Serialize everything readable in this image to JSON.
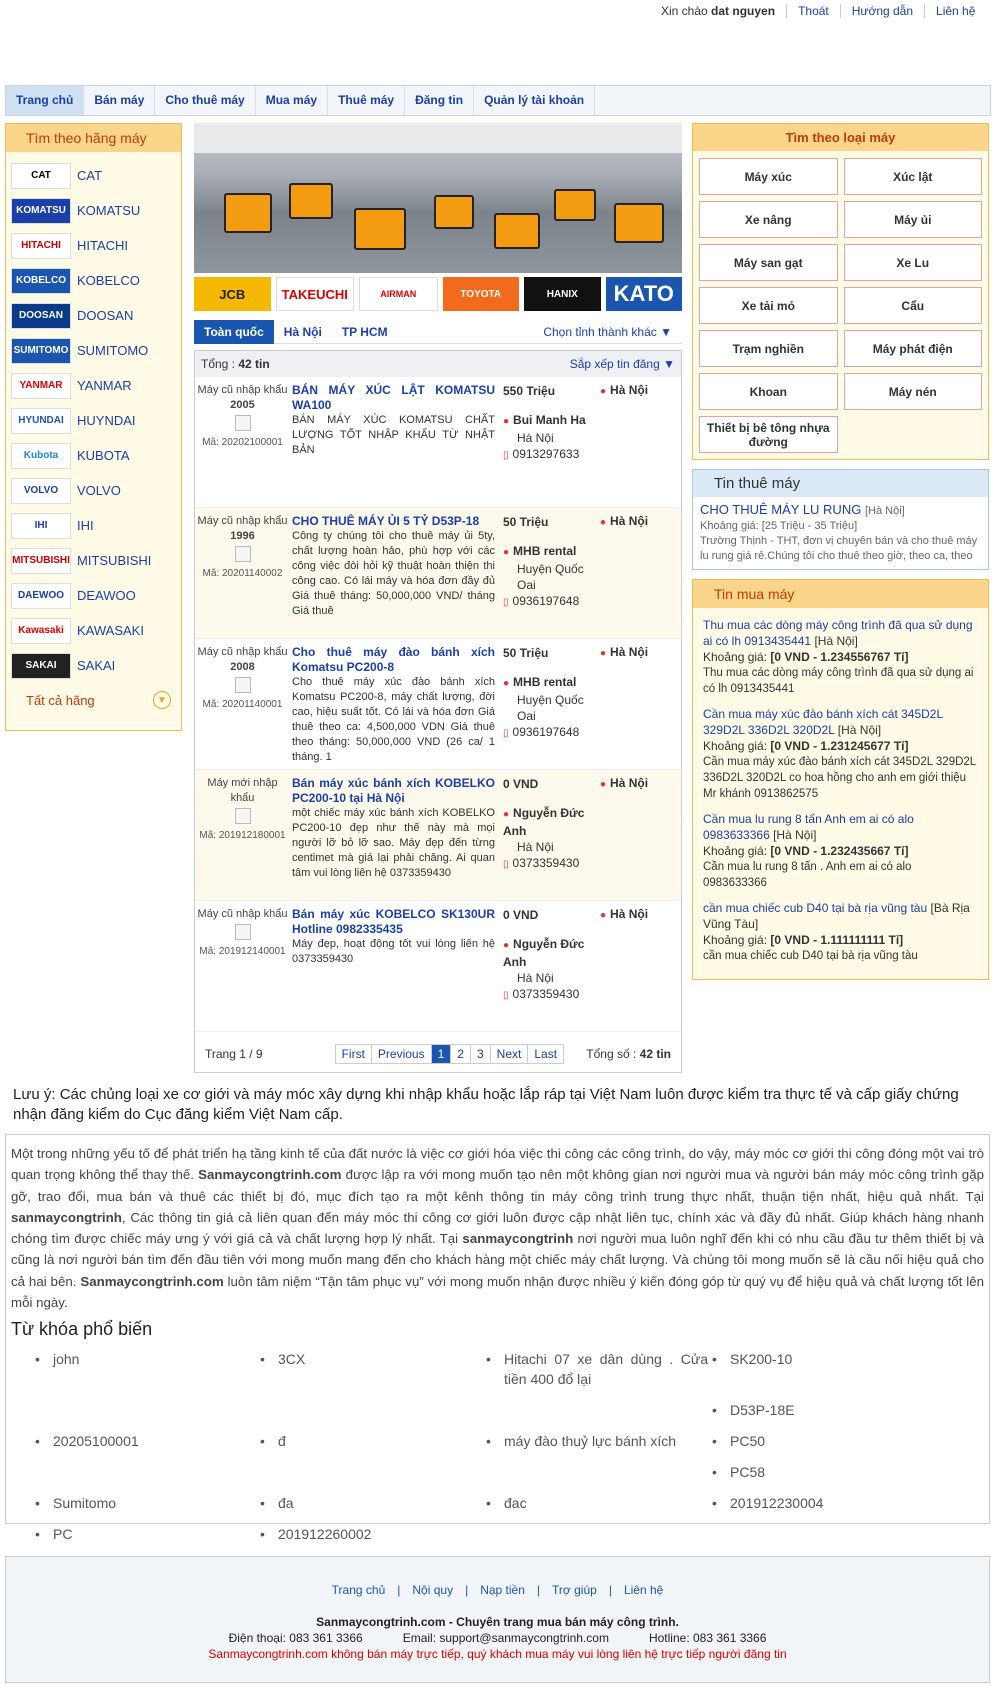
{
  "topbar": {
    "greeting": "Xin chào",
    "user": "dat nguyen",
    "logout": "Thoát",
    "guide": "Hướng dẫn",
    "contact": "Liên hệ"
  },
  "nav": [
    "Trang chủ",
    "Bán máy",
    "Cho thuê máy",
    "Mua máy",
    "Thuê máy",
    "Đăng tin",
    "Quản lý tài khoản"
  ],
  "brands": {
    "title": "Tìm theo hãng máy",
    "items": [
      "CAT",
      "KOMATSU",
      "HITACHI",
      "KOBELCO",
      "DOOSAN",
      "SUMITOMO",
      "YANMAR",
      "HUYNDAI",
      "KUBOTA",
      "VOLVO",
      "IHI",
      "MITSUBISHI",
      "DEAWOO",
      "KAWASAKI",
      "SAKAI"
    ],
    "all": "Tất cả hãng"
  },
  "logos": [
    "JCB",
    "TAKEUCHI",
    "AIRMAN",
    "TOYOTA",
    "HANIX",
    "KATO"
  ],
  "tabs": {
    "all": "Toàn quốc",
    "hn": "Hà Nội",
    "hcm": "TP HCM",
    "city": "Chọn tỉnh thành khác"
  },
  "list": {
    "total_label": "Tổng :",
    "total": "42 tin",
    "sort": "Sắp xếp tin đăng",
    "items": [
      {
        "cond": "Máy cũ nhập khẩu",
        "year": "2005",
        "code": "Mã: 20202100001",
        "title": "BÁN MÁY XÚC LẬT KOMATSU WA100",
        "desc": "BÁN MÁY XÚC KOMATSU CHẤT LƯỢNG TỐT NHẬP KHẨU TỪ NHẬT BẢN",
        "price": "550 Triệu",
        "name": "Bui Manh Ha",
        "addr": "Hà Nội",
        "phone": "0913297633",
        "loc": "Hà Nội"
      },
      {
        "cond": "Máy cũ nhập khẩu",
        "year": "1996",
        "code": "Mã: 20201140002",
        "title": "CHO THUÊ MÁY ỦI 5 TỶ D53P-18",
        "desc": "Công ty chúng tôi cho thuê máy ủi 5ty, chất lượng hoàn hảo, phù hợp với các công việc đòi hỏi kỹ thuật hoàn thiện thi công cao. Có lái máy và hóa đơn đầy đủ Giá thuê tháng: 50,000,000 VND/ tháng Giá thuê",
        "price": "50 Triệu",
        "name": "MHB rental",
        "addr": "Huyện Quốc Oai",
        "phone": "0936197648",
        "loc": "Hà Nội"
      },
      {
        "cond": "Máy cũ nhập khẩu",
        "year": "2008",
        "code": "Mã: 20201140001",
        "title": "Cho thuê máy đào bánh xích Komatsu PC200-8",
        "desc": "Cho thuê máy xúc đào bánh xích Komatsu PC200-8, máy chất lượng, đời cao, hiệu suất tốt. Có lái và hóa đơn Giá thuê theo ca: 4,500,000 VDN Giá thuê theo tháng: 50,000,000 VND (26 ca/ 1 tháng. 1",
        "price": "50 Triệu",
        "name": "MHB rental",
        "addr": "Huyện Quốc Oai",
        "phone": "0936197648",
        "loc": "Hà Nội"
      },
      {
        "cond": "Máy mới nhập khẩu",
        "year": "",
        "code": "Mã: 201912180001",
        "title": "Bán máy xúc bánh xích KOBELKO PC200-10 tại Hà Nội",
        "desc": "một chiếc máy xúc bánh xích KOBELKO PC200-10 đẹp như thế này mà mọi người lỡ bỏ lỡ sao. Máy đẹp đến từng centimet mà giá lại phải chăng. Ai quan tâm vui lòng liên hệ 0373359430",
        "price": "0 VND",
        "name": "Nguyễn Đức Anh",
        "addr": "Hà Nội",
        "phone": "0373359430",
        "loc": "Hà Nội"
      },
      {
        "cond": "Máy cũ nhập khẩu",
        "year": "",
        "code": "Mã: 201912140001",
        "title": "Bán máy xúc KOBELCO SK130UR Hotline 0982335435",
        "desc": "Máy đẹp, hoạt động tốt vui lòng liên hệ 0373359430",
        "price": "0 VND",
        "name": "Nguyễn Đức Anh",
        "addr": "Hà Nội",
        "phone": "0373359430",
        "loc": "Hà Nội"
      }
    ],
    "page_label": "Trang 1 / 9",
    "first": "First",
    "prev": "Previous",
    "pages": [
      "1",
      "2",
      "3"
    ],
    "next": "Next",
    "last": "Last",
    "sum_label": "Tổng số :",
    "sum": "42 tin"
  },
  "types": {
    "title": "Tìm theo loại máy",
    "items": [
      "Máy xúc",
      "Xúc lật",
      "Xe nâng",
      "Máy ủi",
      "Máy san gạt",
      "Xe Lu",
      "Xe tải mỏ",
      "Cẩu",
      "Trạm nghiền",
      "Máy phát điện",
      "Khoan",
      "Máy nén",
      "Thiết bị bê tông nhựa đường"
    ]
  },
  "rent": {
    "title": "Tin thuê máy",
    "link": "CHO THUÊ MÁY LU RUNG",
    "loc": "[Hà Nội]",
    "price": "Khoảng giá: [25 Triệu - 35 Triệu]",
    "desc": "Trường Thịnh - THT, đơn vị chuyên bán và cho thuê máy lu rung giá rẻ.Chúng tôi cho thuê theo giờ, theo ca, theo ngày, theo tháng.... tùy vào nhu cầu của quý"
  },
  "buy": {
    "title": "Tin mua máy",
    "items": [
      {
        "link": "Thu mua các dòng máy công trình đã qua sử dụng ai có lh 0913435441",
        "loc": "[Hà Nội]",
        "price_label": "Khoảng giá:",
        "price": "[0 VND - 1.234556767 Tỉ]",
        "desc": "Thu mua các dòng máy công trình đã qua sử dụng ai có lh 0913435441"
      },
      {
        "link": "Cần mua máy xúc đào bánh xích cát 345D2L 329D2L 336D2L 320D2L",
        "loc": "[Hà Nội]",
        "price_label": "Khoảng giá:",
        "price": "[0 VND - 1.231245677 Tỉ]",
        "desc": "Cần mua máy xúc đào bánh xích cát 345D2L 329D2L 336D2L 320D2L co hoa hồng cho anh em giới thiệu Mr khánh 0913862575"
      },
      {
        "link": "Cần mua lu rung 8 tấn Anh em ai có alo 0983633366",
        "loc": "[Hà Nội]",
        "price_label": "Khoảng giá:",
        "price": "[0 VND - 1.232435667 Tỉ]",
        "desc": "Cần mua lu rung 8 tấn . Anh em ai có alo 0983633366"
      },
      {
        "link": "cần mua chiếc cub D40 tại bà rịa vũng tàu",
        "loc": "[Bà Rịa Vũng Tàu]",
        "price_label": "Khoảng giá:",
        "price": "[0 VND - 1.111111111 Tỉ]",
        "desc": "cần mua chiếc cub D40 tại bà rịa vũng tàu"
      }
    ]
  },
  "note": "Lưu ý: Các chủng loại xe cơ giới và máy móc xây dựng khi nhập khẩu hoặc lắp ráp tại Việt Nam luôn được kiểm tra thực tế và cấp giấy chứng nhận đăng kiểm do Cục đăng kiểm Việt Nam cấp.",
  "about": {
    "p1": "Một trong những yếu tố để phát triển hạ tầng kinh tế của đất nước là việc cơ giới hóa việc thi công các công trình, do vậy, máy móc cơ giới thi công đóng một vai trò quan trọng không thể thay thế. ",
    "b1": "Sanmaycongtrinh.com",
    "p2": " được lập ra với mong muốn tạo nên một không gian nơi người mua và người bán máy móc công trình gặp gỡ, trao đổi, mua bán và thuê các thiết bị đó, mục đích tạo ra một kênh thông tin máy công trình trung thực nhất, thuận tiện nhất, hiệu quả nhất. Tại ",
    "b2": "sanmaycongtrinh",
    "p3": ", Các thông tin giá cả liên quan đến máy móc thi công cơ giới luôn được cập nhật liên tục, chính xác và đầy đủ nhất. Giúp khách hàng nhanh chóng tìm được chiếc máy ưng ý với giá cả và chất lượng hợp lý nhất. Tại ",
    "b3": "sanmaycongtrinh",
    "p4": " nơi người mua luôn nghĩ đến khi có nhu cầu đầu tư thêm thiết bị và cũng là nơi người bán tìm đến đầu tiên với mong muốn mang đến cho khách hàng một chiếc máy chất lượng. Và chúng tôi mong muốn sẽ là cầu nối hiệu quả cho cả hai bên. ",
    "b4": "Sanmaycongtrinh.com",
    "p5": " luôn tâm niệm “Tận tâm phục vụ” với mong muốn nhận được nhiều ý kiến đóng góp từ quý vụ để hiệu quả và chất lượng tốt lên mỗi ngày.",
    "kw_title": "Từ khóa phổ biến",
    "keywords": [
      "john",
      "3CX",
      "Hitachi 07 xe dân dùng . Cửa tiền 400 đổ lại",
      "SK200-10",
      "",
      "",
      "",
      "D53P-18E",
      "20205100001",
      "đ",
      "máy đào thuỷ lực bánh xích",
      "PC50",
      "",
      "",
      "",
      "PC58",
      "Sumitomo",
      "đa",
      "đac",
      "201912230004",
      "PC",
      "201912260002",
      "",
      ""
    ]
  },
  "footer": {
    "links": [
      "Trang chủ",
      "Nội quy",
      "Nạp tiền",
      "Trợ giúp",
      "Liên hệ"
    ],
    "sep": "|",
    "line1": "Sanmaycongtrinh.com - Chuyên trang mua bán máy công trình.",
    "phone": "Điện thoại: 083 361 3366",
    "email": "Email: support@sanmaycongtrinh.com",
    "hotline": "Hotline: 083 361 3366",
    "warn": "Sanmaycongtrinh.com không bán máy trực tiếp, quý khách mua máy vui lòng liên hệ trực tiếp người đăng tin"
  }
}
